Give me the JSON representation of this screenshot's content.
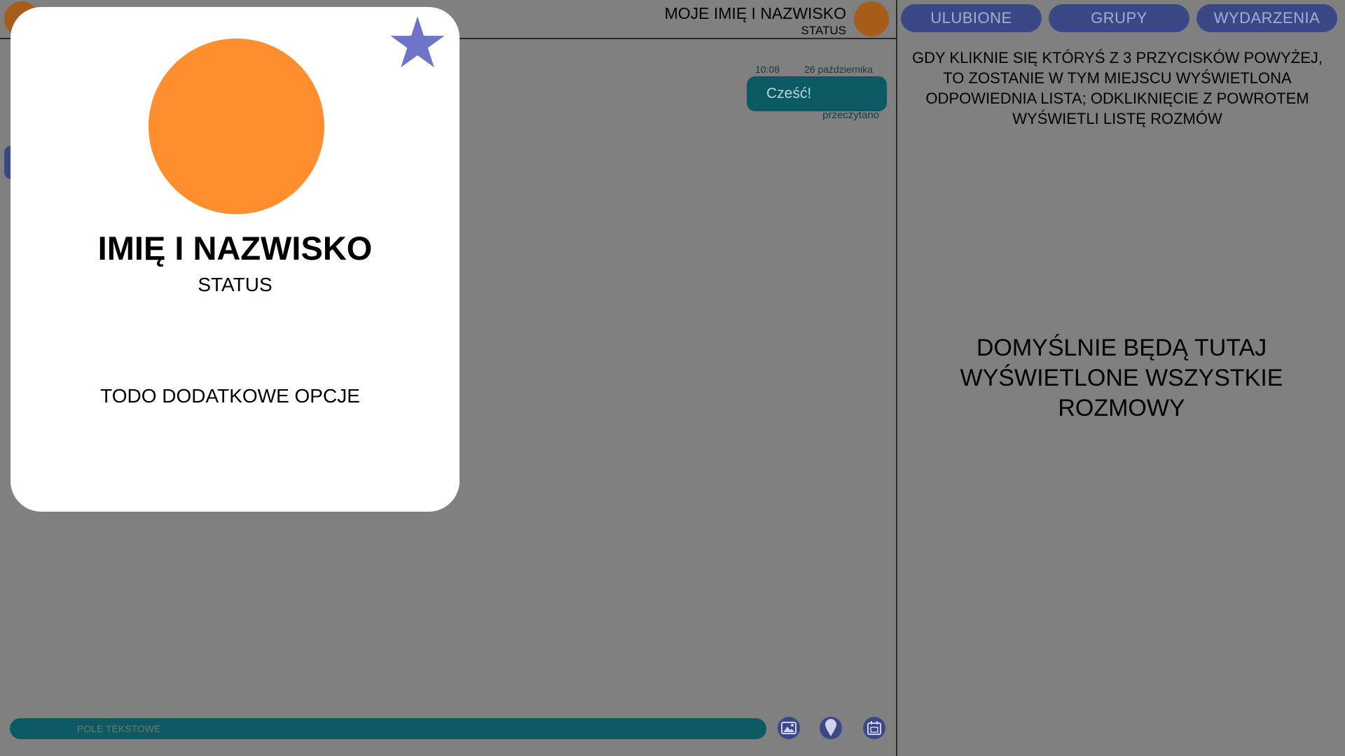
{
  "header": {
    "user_name": "MOJE IMIĘ I NAZWISKO",
    "user_status": "STATUS"
  },
  "conversation": {
    "message": {
      "time": "10:08",
      "date": "26 października",
      "text": "Cześć!",
      "read_status": "przeczytano"
    },
    "text_field_placeholder": "POLE TEKSTOWE",
    "tools": [
      {
        "icon": "image-icon"
      },
      {
        "icon": "location-pin-icon"
      },
      {
        "icon": "calendar-icon"
      }
    ]
  },
  "right_panel": {
    "buttons": [
      {
        "label": "ULUBIONE"
      },
      {
        "label": "GRUPY"
      },
      {
        "label": "WYDARZENIA"
      }
    ],
    "info_text": "GDY KLIKNIE SIĘ KTÓRYŚ Z 3 PRZYCISKÓW POWYŻEJ, TO ZOSTANIE W TYM MIEJSCU WYŚWIETLONA ODPOWIEDNIA LISTA; ODKLIKNIĘCIE Z POWROTEM WYŚWIETLI LISTĘ ROZMÓW",
    "default_text": "DOMYŚLNIE BĘDĄ TUTAJ WYŚWIETLONE WSZYSTKIE ROZMOWY"
  },
  "profile_card": {
    "name": "IMIĘ I NAZWISKO",
    "status": "STATUS",
    "options_text": "TODO DODATKOWE OPCJE",
    "favorite_icon": "star-icon"
  },
  "colors": {
    "background": "#808080",
    "accent_orange": "#ff8f2e",
    "accent_teal": "#0b5a63",
    "accent_blue": "#3b4886",
    "star": "#6f73c9"
  }
}
